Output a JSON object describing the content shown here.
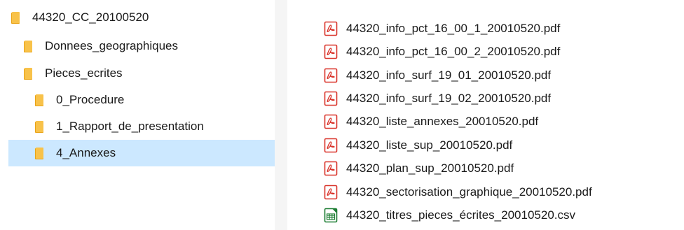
{
  "colors": {
    "selection": "#cce8ff",
    "folder": "#f8c24a",
    "pdf_red": "#d9342b",
    "csv_green": "#1e7e34",
    "gutter": "#f5f5f5"
  },
  "tree": {
    "items": [
      {
        "label": "44320_CC_20100520",
        "icon": "folder-icon",
        "selected": false
      },
      {
        "label": "Donnees_geographiques",
        "icon": "folder-icon",
        "selected": false
      },
      {
        "label": "Pieces_ecrites",
        "icon": "folder-icon",
        "selected": false
      },
      {
        "label": "0_Procedure",
        "icon": "folder-icon",
        "selected": false
      },
      {
        "label": "1_Rapport_de_presentation",
        "icon": "folder-icon",
        "selected": false
      },
      {
        "label": "4_Annexes",
        "icon": "folder-icon",
        "selected": true
      }
    ]
  },
  "files": [
    {
      "name": "44320_info_pct_16_00_1_20010520.pdf",
      "icon": "pdf-file-icon"
    },
    {
      "name": "44320_info_pct_16_00_2_20010520.pdf",
      "icon": "pdf-file-icon"
    },
    {
      "name": "44320_info_surf_19_01_20010520.pdf",
      "icon": "pdf-file-icon"
    },
    {
      "name": "44320_info_surf_19_02_20010520.pdf",
      "icon": "pdf-file-icon"
    },
    {
      "name": "44320_liste_annexes_20010520.pdf",
      "icon": "pdf-file-icon"
    },
    {
      "name": "44320_liste_sup_20010520.pdf",
      "icon": "pdf-file-icon"
    },
    {
      "name": "44320_plan_sup_20010520.pdf",
      "icon": "pdf-file-icon"
    },
    {
      "name": "44320_sectorisation_graphique_20010520.pdf",
      "icon": "pdf-file-icon"
    },
    {
      "name": "44320_titres_pieces_écrites_20010520.csv",
      "icon": "csv-file-icon"
    }
  ]
}
